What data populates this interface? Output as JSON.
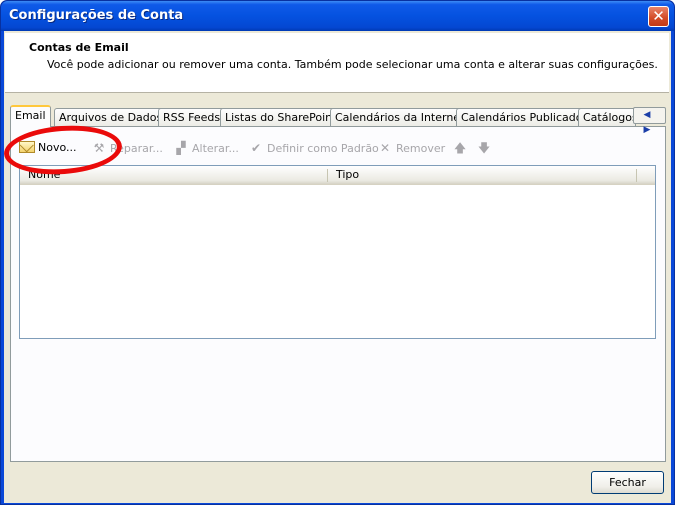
{
  "window": {
    "title": "Configurações de Conta",
    "close_glyph": "✕"
  },
  "header": {
    "title": "Contas de Email",
    "subtitle": "Você pode adicionar ou remover uma conta. Também pode selecionar uma conta e alterar suas configurações."
  },
  "tabs": [
    {
      "label": "Email",
      "active": true
    },
    {
      "label": "Arquivos de Dados"
    },
    {
      "label": "RSS Feeds"
    },
    {
      "label": "Listas do SharePoint"
    },
    {
      "label": "Calendários da Internet"
    },
    {
      "label": "Calendários Publicados"
    },
    {
      "label": "Catálogos"
    }
  ],
  "tab_scroll": "◀ ▶",
  "toolbar": {
    "new_label": "Novo...",
    "repair_label": "Reparar...",
    "change_label": "Alterar...",
    "default_label": "Definir como Padrão",
    "remove_label": "Remover",
    "up_glyph": "🡅",
    "down_glyph": "🡇",
    "new_icon": "envelope-icon",
    "repair_icon": "tools-icon",
    "change_icon": "edit-icon",
    "default_icon": "checkmark-icon",
    "remove_icon": "x-icon"
  },
  "list": {
    "columns": [
      "Nome",
      "Tipo"
    ],
    "rows": []
  },
  "footer": {
    "close_label": "Fechar"
  },
  "colors": {
    "title_bar": "#0552e0",
    "annotation": "#ea0a0a",
    "active_tab_accent": "#ffc83c"
  }
}
